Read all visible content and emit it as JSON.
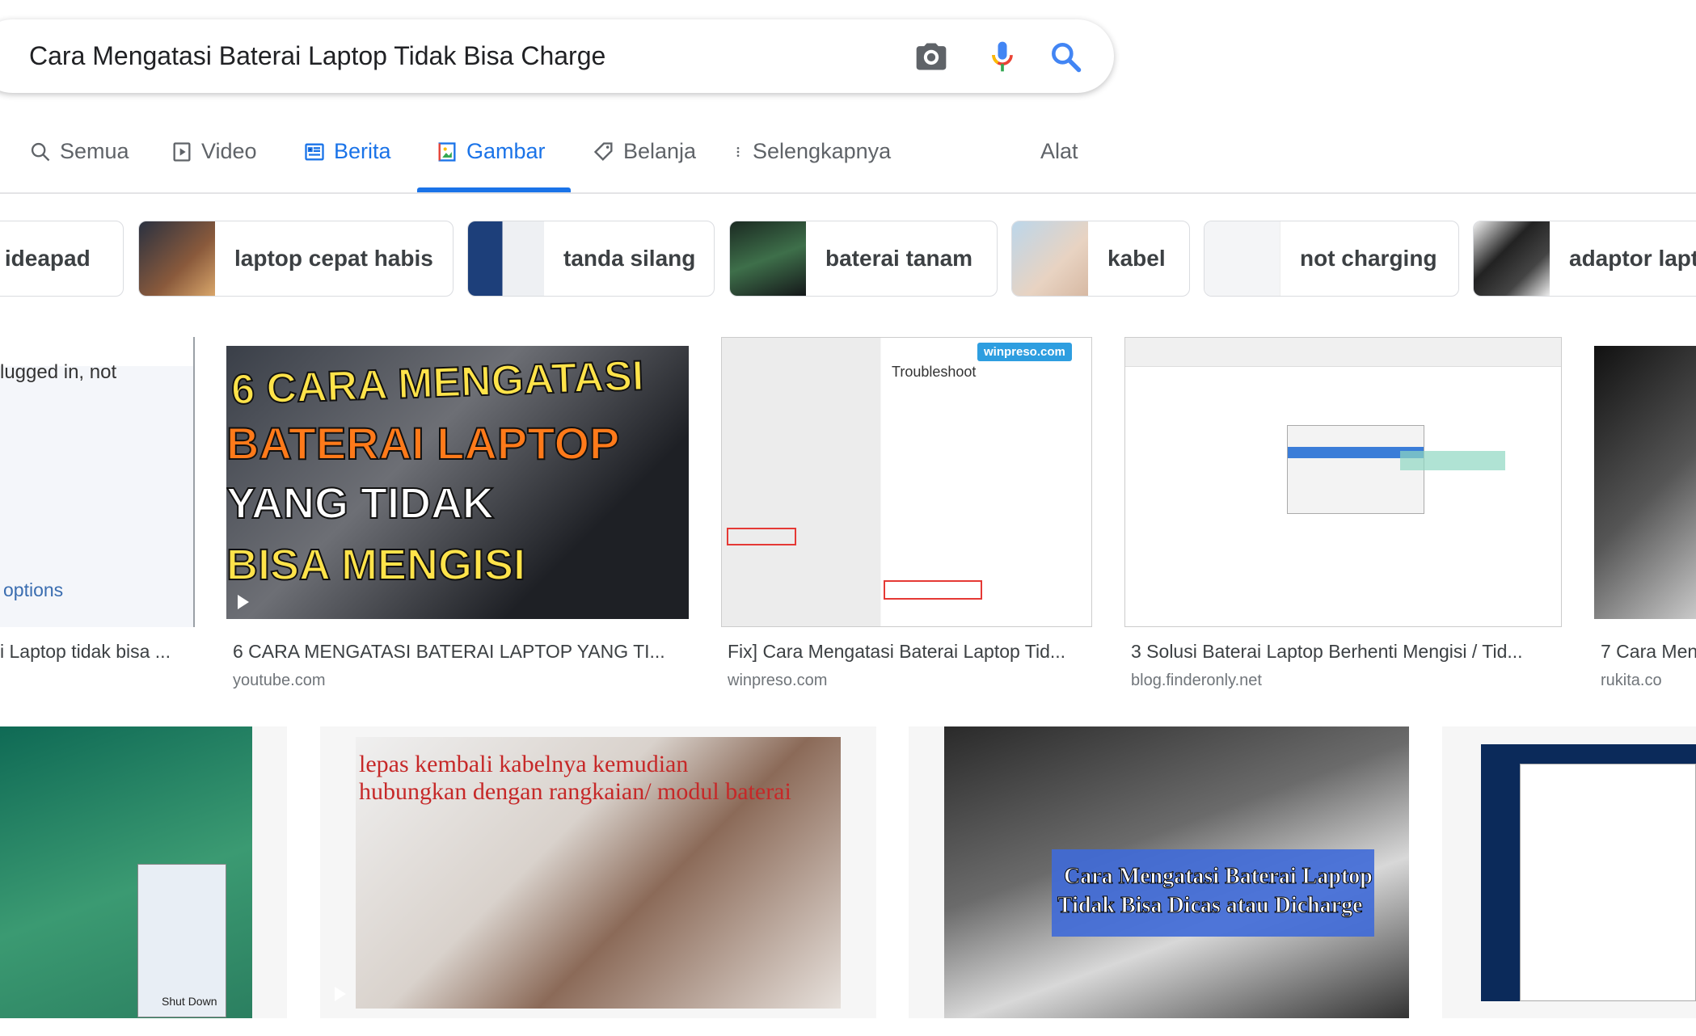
{
  "search": {
    "query": "Cara Mengatasi Baterai Laptop Tidak Bisa Charge",
    "icons": [
      "camera-icon",
      "microphone-icon",
      "search-icon"
    ]
  },
  "tabs": [
    {
      "label": "Semua",
      "icon": "search-icon",
      "active": false
    },
    {
      "label": "Video",
      "icon": "video-icon",
      "active": false
    },
    {
      "label": "Berita",
      "icon": "news-icon",
      "active": false
    },
    {
      "label": "Gambar",
      "icon": "image-icon",
      "active": true
    },
    {
      "label": "Belanja",
      "icon": "tag-icon",
      "active": false
    },
    {
      "label": "Selengkapnya",
      "icon": "more-vert-icon",
      "active": false
    }
  ],
  "tools_label": "Alat",
  "chips": [
    {
      "label": "o ideapad"
    },
    {
      "label": "laptop cepat habis"
    },
    {
      "label": "tanda silang"
    },
    {
      "label": "baterai tanam"
    },
    {
      "label": "kabel"
    },
    {
      "label": "not charging"
    },
    {
      "label": "adaptor lapt"
    }
  ],
  "results_row1": [
    {
      "caption": "i Laptop tidak bisa ...",
      "source": "",
      "overlay": "lugged in, not",
      "overlay2": "options"
    },
    {
      "caption": "6 CARA MENGATASI BATERAI LAPTOP YANG TI...",
      "source": "youtube.com",
      "overlay": "6 CARA MENGATASI",
      "overlay2": "BATERAI LAPTOP",
      "overlay3": "YANG TIDAK",
      "overlay4": "BISA MENGISI",
      "video": true
    },
    {
      "caption": "Fix] Cara Mengatasi Baterai Laptop Tid...",
      "source": "winpreso.com",
      "overlay": "Troubleshoot",
      "overlay2": "winpreso.com"
    },
    {
      "caption": "3 Solusi Baterai Laptop Berhenti Mengisi / Tid...",
      "source": "blog.finderonly.net"
    },
    {
      "caption": "7 Cara Men",
      "source": "rukita.co"
    }
  ],
  "results_row2": [
    {
      "overlay": "Shut Down"
    },
    {
      "overlay": "lepas kembali kabelnya kemudian",
      "overlay2": "hubungkan dengan rangkaian/ modul baterai",
      "video": true
    },
    {
      "overlay": "Cara Mengatasi Baterai Laptop",
      "overlay2": "Tidak Bisa Dicas atau Dicharge"
    },
    {}
  ],
  "colors": {
    "accent": "#1a73e8",
    "text": "#202124",
    "muted": "#70757a"
  }
}
